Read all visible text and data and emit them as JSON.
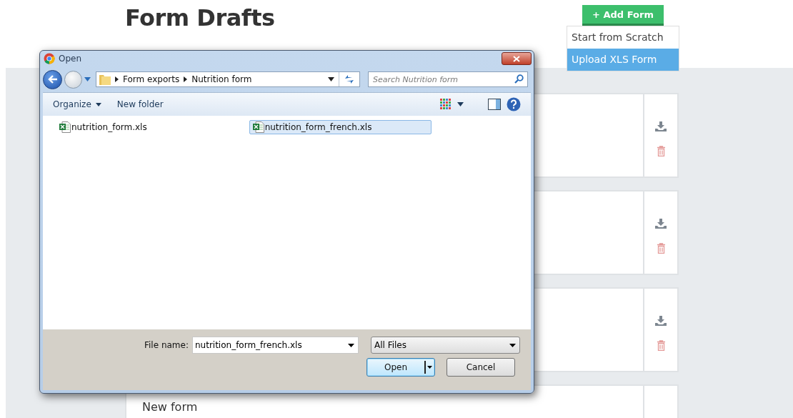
{
  "page": {
    "title": "Form Drafts"
  },
  "add_form": {
    "label": "+ Add Form",
    "menu": [
      {
        "label": "Start from Scratch",
        "selected": false
      },
      {
        "label": "Upload XLS Form",
        "selected": true
      }
    ]
  },
  "cards": [
    {
      "actions": true
    },
    {
      "actions": true
    },
    {
      "actions": true
    },
    {
      "title": "New form",
      "actions": false
    }
  ],
  "dialog": {
    "title": "Open",
    "path": [
      "Form exports",
      "Nutrition form"
    ],
    "search": {
      "placeholder": "Search Nutrition form"
    },
    "toolbar": {
      "organize": "Organize",
      "new_folder": "New folder"
    },
    "files": [
      {
        "name": "nutrition_form.xls",
        "selected": false
      },
      {
        "name": "nutrition_form_french.xls",
        "selected": true
      }
    ],
    "file_name_label": "File name:",
    "file_name": "nutrition_form_french.xls",
    "file_type": "All Files",
    "open": "Open",
    "cancel": "Cancel"
  }
}
